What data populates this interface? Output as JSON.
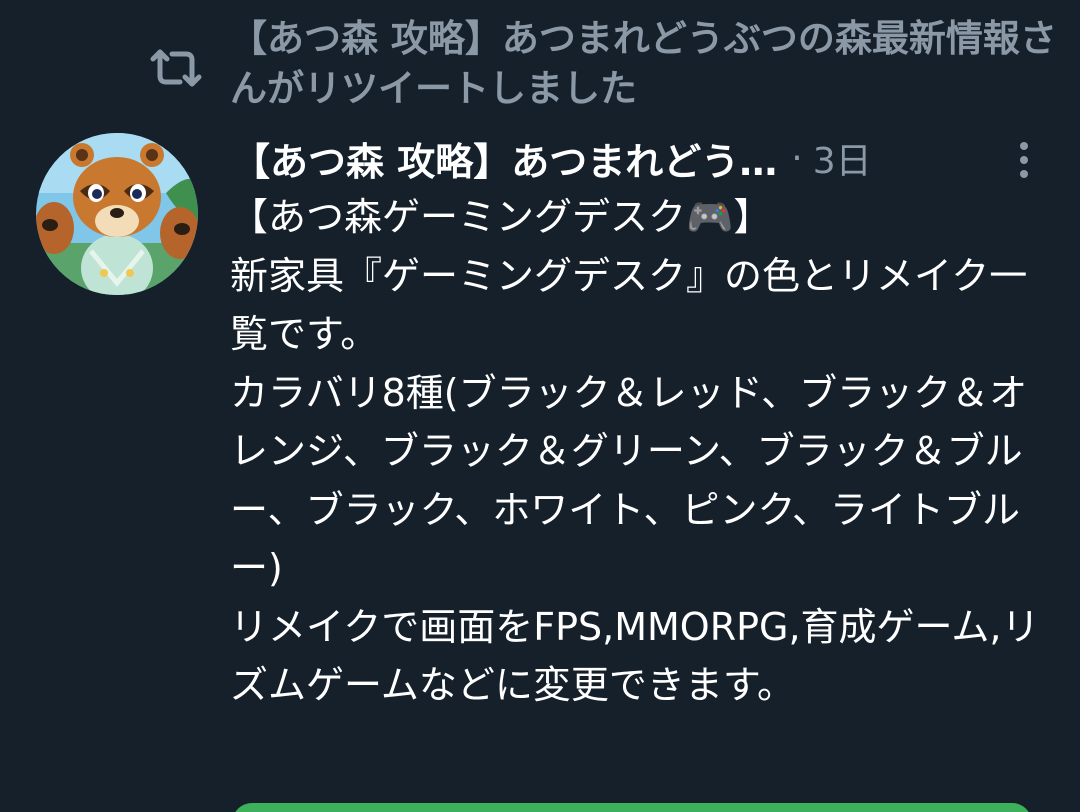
{
  "retweet": {
    "icon": "retweet-icon",
    "text": "【あつ森 攻略】あつまれどうぶつの森最新情報さんがリツイートしました"
  },
  "tweet": {
    "avatar_icon": "raccoon-character-avatar",
    "author": "【あつ森 攻略】あつまれどう…",
    "separator": "·",
    "time": "3日",
    "more_icon": "more-vertical-icon",
    "body": "【あつ森ゲーミングデスク🎮】\n新家具『ゲーミングデスク』の色とリメイク一覧です。\nカラバリ8種(ブラック＆レッド、ブラック＆オレンジ、ブラック＆グリーン、ブラック＆ブルー、ブラック、ホワイト、ピンク、ライトブルー)\nリメイクで画面をFPS,MMORPG,育成ゲーム,リズムゲームなどに変更できます。"
  },
  "colors": {
    "background": "#15202b",
    "secondary_text": "#8b98a5",
    "primary_text": "#ffffff",
    "card_accent": "#3cb05a"
  }
}
